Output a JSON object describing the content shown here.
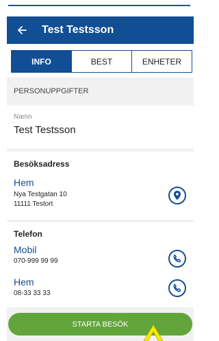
{
  "app_bar": {
    "title": "Test Testsson"
  },
  "tabs": [
    {
      "label": "INFO",
      "active": true
    },
    {
      "label": "BEST",
      "active": false
    },
    {
      "label": "ENHETER",
      "active": false
    }
  ],
  "section": {
    "title": "PERSONUPPGIFTER"
  },
  "name_field": {
    "label": "Namn",
    "value": "Test Testsson"
  },
  "address": {
    "group_label": "Besöksadress",
    "title": "Hem",
    "street": "Nya Testgatan 10",
    "city": "11111 Testort"
  },
  "phone": {
    "group_label": "Telefon",
    "entries": [
      {
        "title": "Mobil",
        "number": "070-999 99 99"
      },
      {
        "title": "Hem",
        "number": "08-33 33 33"
      }
    ]
  },
  "actions": {
    "start_visit": "STARTA BESÖK"
  },
  "colors": {
    "primary": "#124e94",
    "accent_green": "#62a43c",
    "cursor_yellow": "#ffeb00"
  },
  "icons": [
    "back-arrow-icon",
    "location-pin-icon",
    "phone-icon"
  ]
}
